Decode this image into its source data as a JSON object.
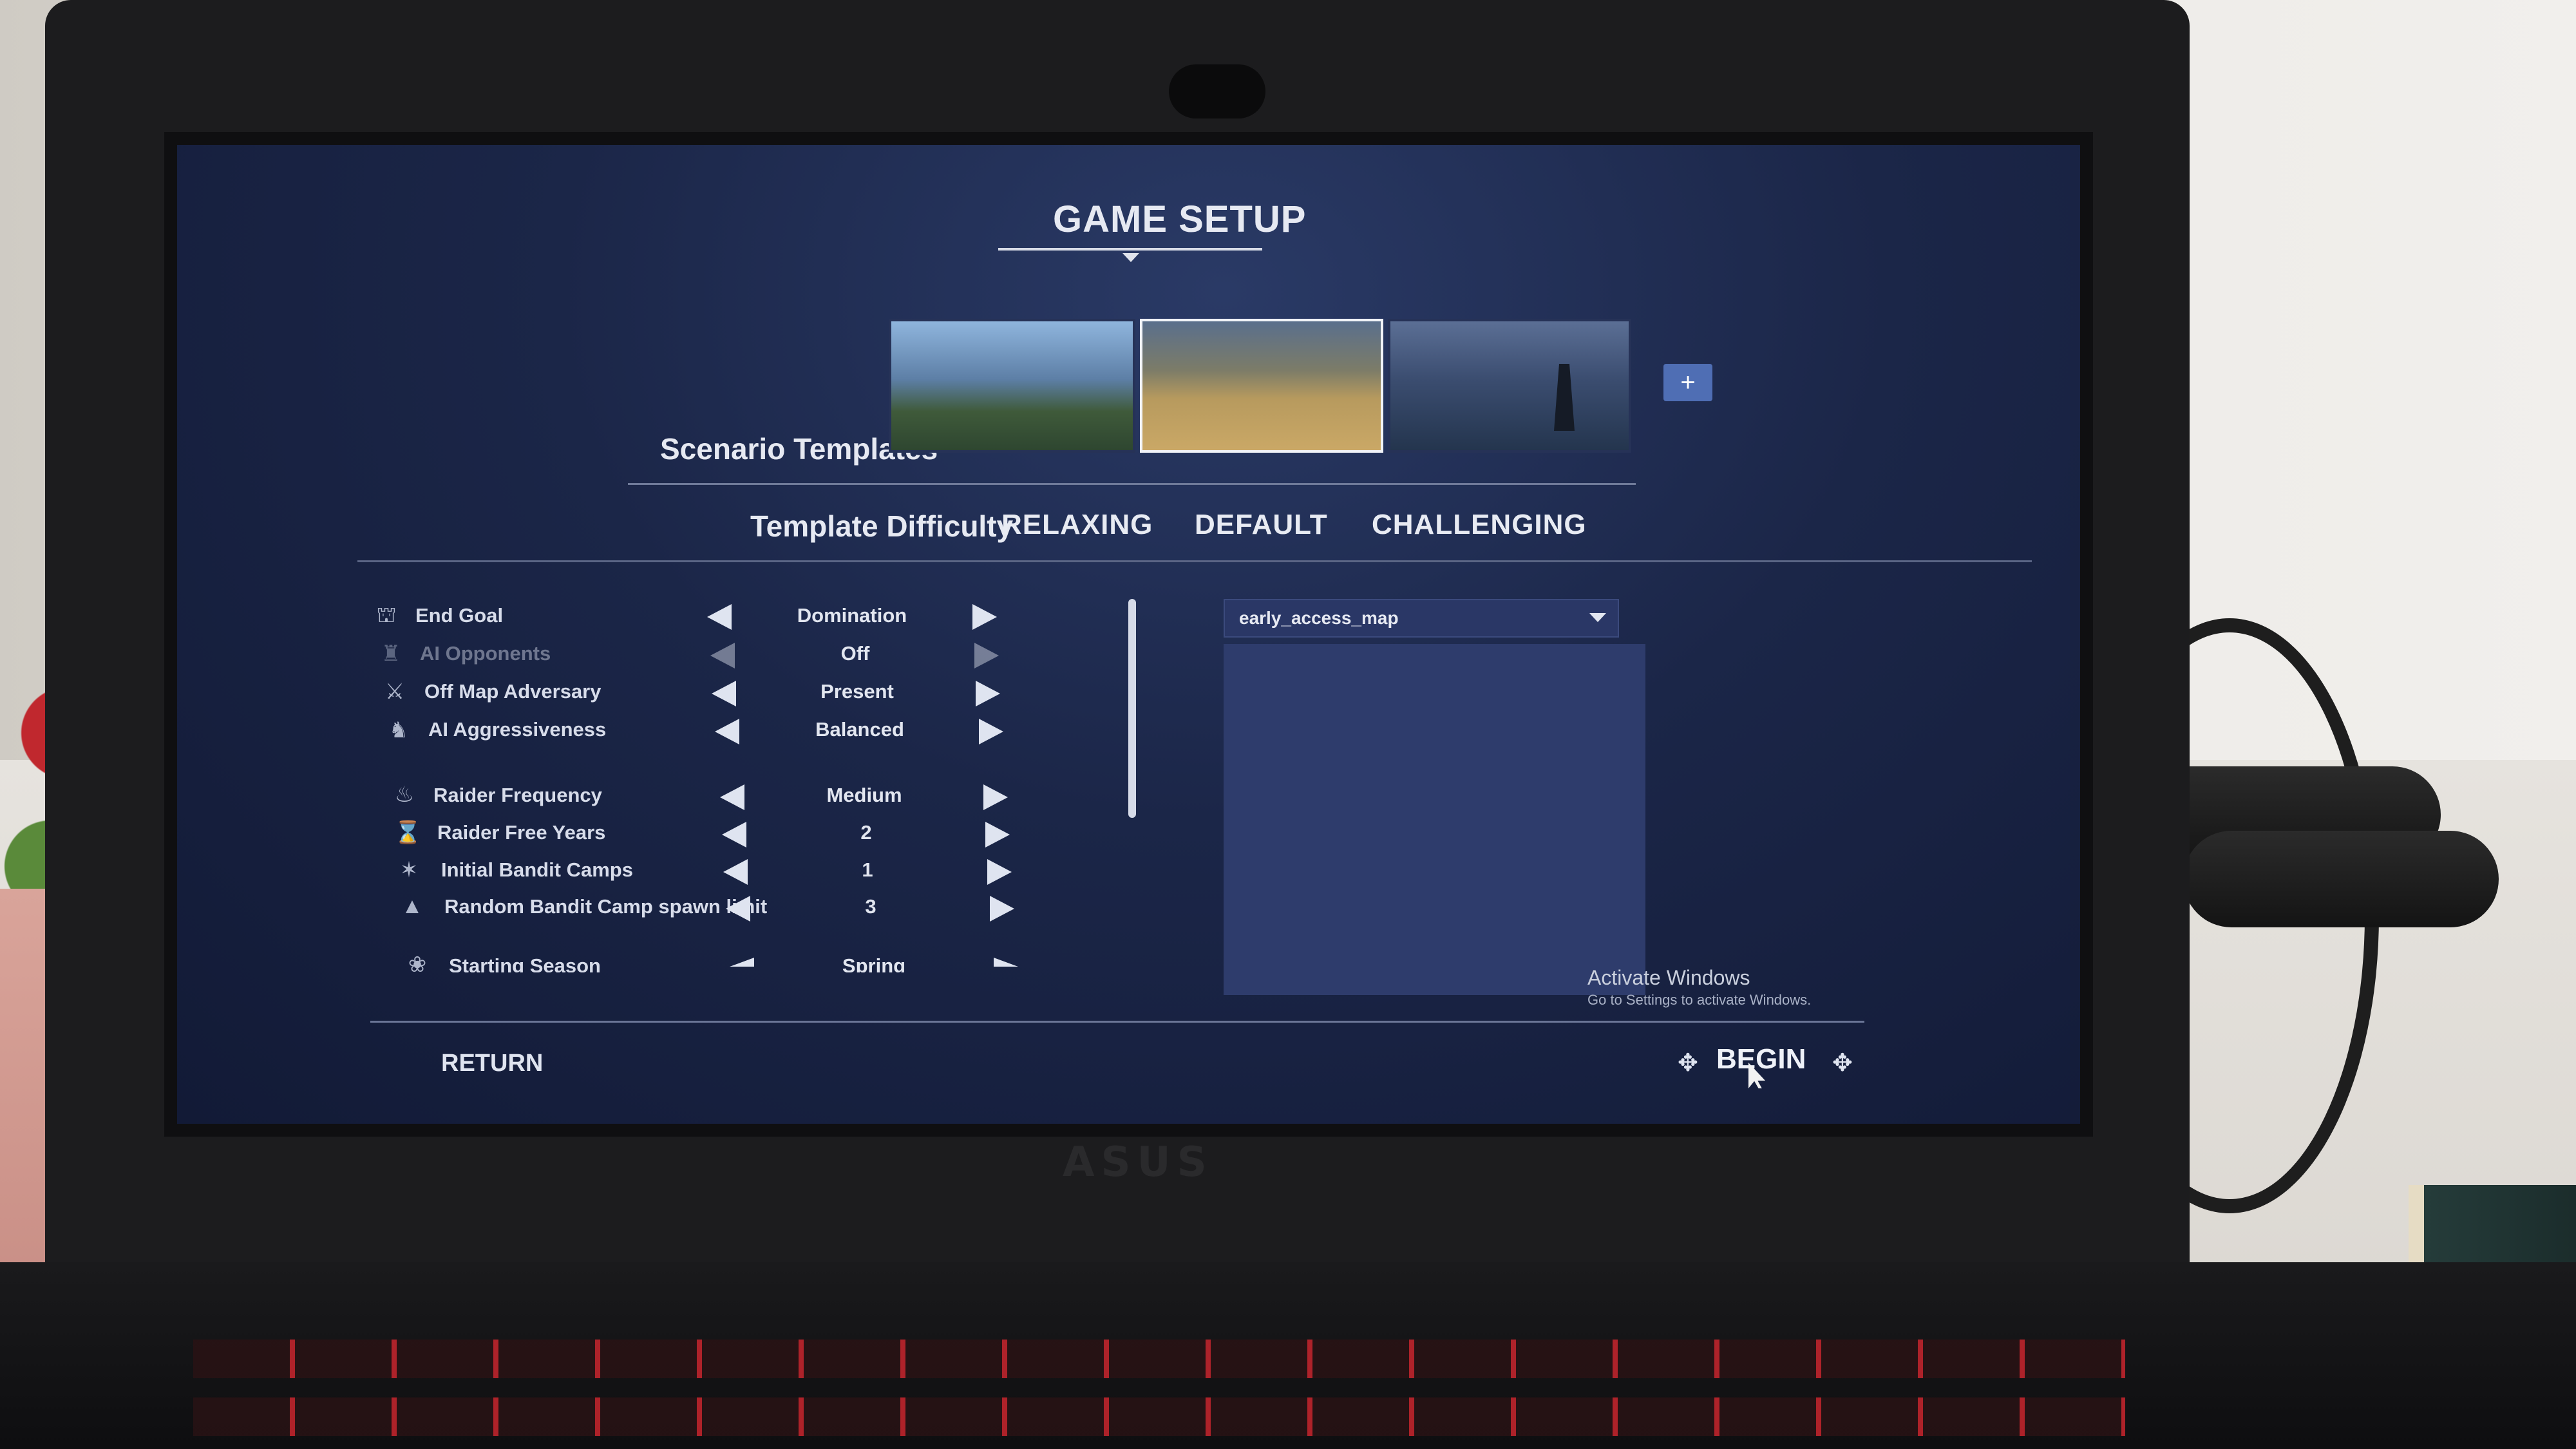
{
  "game": {
    "title": "GAME SETUP",
    "scenario_templates_label": "Scenario Templates",
    "add_template_label": "+",
    "difficulty": {
      "label": "Template Difficulty",
      "options": [
        "RELAXING",
        "DEFAULT",
        "CHALLENGING"
      ]
    },
    "settings": [
      {
        "label": "End Goal",
        "value": "Domination",
        "icon": "castle-icon"
      },
      {
        "label": "AI Opponents",
        "value": "Off",
        "icon": "opponents-icon"
      },
      {
        "label": "Off Map Adversary",
        "value": "Present",
        "icon": "crossed-swords-icon"
      },
      {
        "label": "AI Aggressiveness",
        "value": "Balanced",
        "icon": "horse-head-icon"
      },
      {
        "label": "Raider Frequency",
        "value": "Medium",
        "icon": "fire-icon"
      },
      {
        "label": "Raider Free Years",
        "value": "2",
        "icon": "hourglass-icon"
      },
      {
        "label": "Initial Bandit Camps",
        "value": "1",
        "icon": "camp-icon"
      },
      {
        "label": "Random Bandit Camp spawn limit",
        "value": "3",
        "icon": "tent-icon"
      },
      {
        "label": "Starting Season",
        "value": "Spring",
        "icon": "season-icon"
      }
    ],
    "map": {
      "selected": "early_access_map"
    },
    "footer": {
      "return_label": "RETURN",
      "begin_label": "BEGIN"
    }
  },
  "os": {
    "activate_title": "Activate Windows",
    "activate_subtitle": "Go to Settings to activate Windows."
  },
  "laptop": {
    "brand": "ASUS"
  }
}
